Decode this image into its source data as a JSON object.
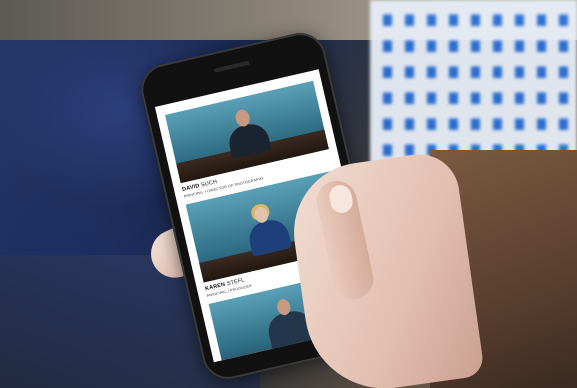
{
  "screen": {
    "team": [
      {
        "first": "DAVID",
        "last": "SUCH",
        "role": "PRINCIPAL / DIRECTOR OF PHOTOGRAPHY"
      },
      {
        "first": "KAREN",
        "last": "STEFL",
        "role": "PRINCIPAL / PRODUCER"
      },
      {
        "first": "",
        "last": "",
        "role": ""
      }
    ]
  },
  "colors": {
    "photo_background": "#3f8aa3",
    "shirt_blue": "#2a6fd6"
  }
}
